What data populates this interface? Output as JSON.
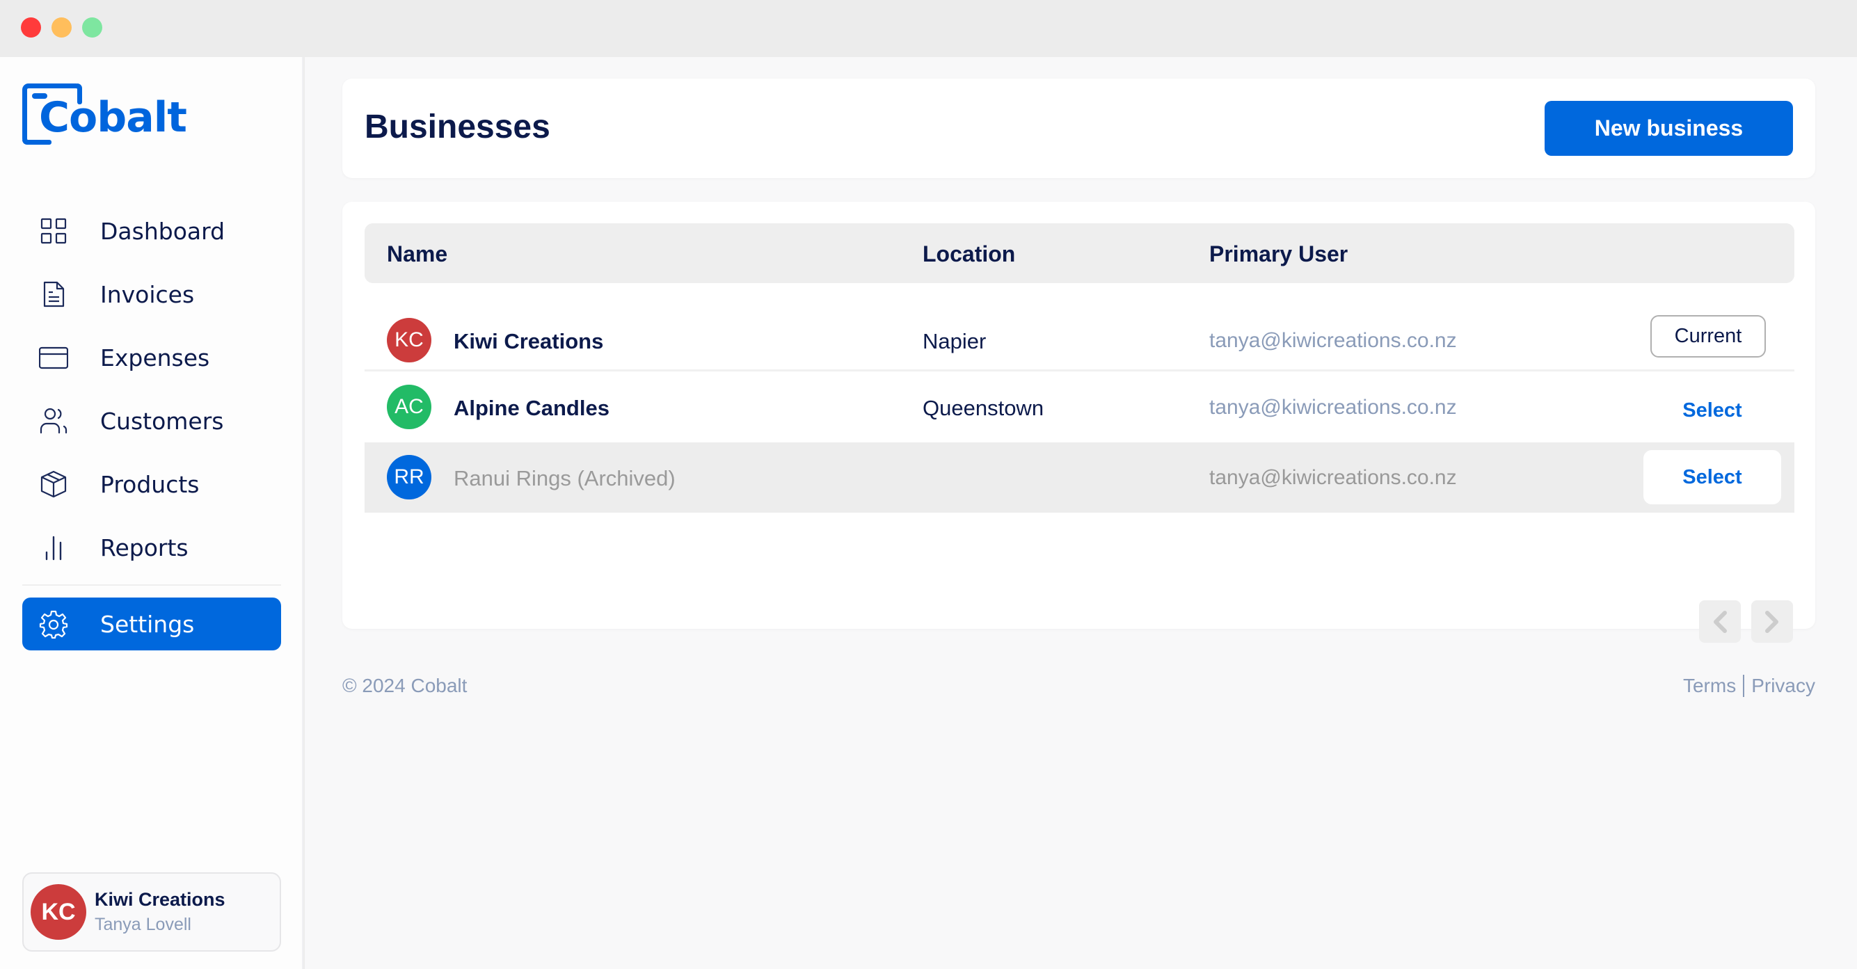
{
  "window": {
    "controls": [
      "close",
      "minimize",
      "maximize"
    ]
  },
  "brand": {
    "name": "Cobalt",
    "color": "#0065dd"
  },
  "sidebar": {
    "items": [
      {
        "label": "Dashboard",
        "icon": "grid-icon",
        "active": false
      },
      {
        "label": "Invoices",
        "icon": "document-icon",
        "active": false
      },
      {
        "label": "Expenses",
        "icon": "credit-card-icon",
        "active": false
      },
      {
        "label": "Customers",
        "icon": "users-icon",
        "active": false
      },
      {
        "label": "Products",
        "icon": "box-icon",
        "active": false
      },
      {
        "label": "Reports",
        "icon": "bar-chart-icon",
        "active": false
      },
      {
        "label": "Settings",
        "icon": "gear-icon",
        "active": true
      }
    ],
    "user_card": {
      "initials": "KC",
      "business": "Kiwi Creations",
      "name": "Tanya Lovell",
      "avatar_color": "#cc3c3c"
    }
  },
  "header": {
    "title": "Businesses",
    "new_button_label": "New business"
  },
  "table": {
    "columns": [
      "Name",
      "Location",
      "Primary User"
    ],
    "rows": [
      {
        "initials": "KC",
        "avatar_color": "#cc3c3c",
        "name": "Kiwi Creations",
        "location": "Napier",
        "primary_user": "tanya@kiwicreations.co.nz",
        "action": "Current",
        "archived": false
      },
      {
        "initials": "AC",
        "avatar_color": "#22bb66",
        "name": "Alpine Candles",
        "location": "Queenstown",
        "primary_user": "tanya@kiwicreations.co.nz",
        "action": "Select",
        "archived": false
      },
      {
        "initials": "RR",
        "avatar_color": "#0068dd",
        "name": "Ranui Rings (Archived)",
        "location": "",
        "primary_user": "tanya@kiwicreations.co.nz",
        "action": "Select",
        "archived": true
      }
    ],
    "pagination": {
      "prev_icon": "chevron-left-icon",
      "next_icon": "chevron-right-icon"
    }
  },
  "footer": {
    "copyright": "© 2024 Cobalt",
    "links": [
      "Terms",
      "Privacy"
    ]
  },
  "colors": {
    "accent": "#0068dd",
    "text_primary": "#0c1a4b",
    "text_muted": "#8a9bb8"
  }
}
